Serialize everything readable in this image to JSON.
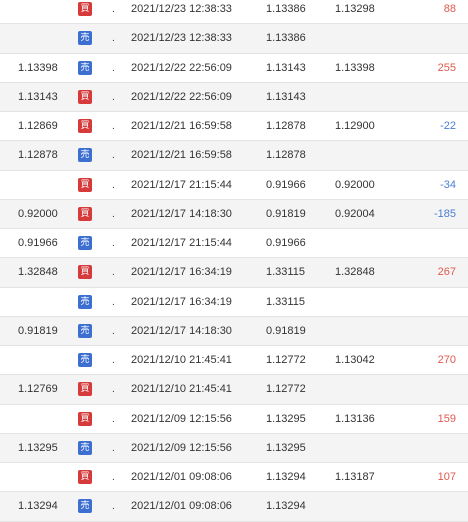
{
  "badges": {
    "buy": "買",
    "sell": "売"
  },
  "colors": {
    "buy_badge": "#d63b3b",
    "sell_badge": "#3d6fd1",
    "profit": "#e05a4f",
    "loss": "#4a7ed6",
    "row_shade": "#f4f4f4"
  },
  "rows": [
    {
      "price1": "",
      "side": "買",
      "dot": ".",
      "datetime": "2021/12/23 12:38:33",
      "price2": "1.13386",
      "price3": "1.13298",
      "pnl": "88"
    },
    {
      "price1": "",
      "side": "売",
      "dot": ".",
      "datetime": "2021/12/23 12:38:33",
      "price2": "1.13386",
      "price3": "",
      "pnl": ""
    },
    {
      "price1": "1.13398",
      "side": "売",
      "dot": ".",
      "datetime": "2021/12/22 22:56:09",
      "price2": "1.13143",
      "price3": "1.13398",
      "pnl": "255"
    },
    {
      "price1": "1.13143",
      "side": "買",
      "dot": ".",
      "datetime": "2021/12/22 22:56:09",
      "price2": "1.13143",
      "price3": "",
      "pnl": ""
    },
    {
      "price1": "1.12869",
      "side": "買",
      "dot": ".",
      "datetime": "2021/12/21 16:59:58",
      "price2": "1.12878",
      "price3": "1.12900",
      "pnl": "-22"
    },
    {
      "price1": "1.12878",
      "side": "売",
      "dot": ".",
      "datetime": "2021/12/21 16:59:58",
      "price2": "1.12878",
      "price3": "",
      "pnl": ""
    },
    {
      "price1": "",
      "side": "買",
      "dot": ".",
      "datetime": "2021/12/17 21:15:44",
      "price2": "0.91966",
      "price3": "0.92000",
      "pnl": "-34"
    },
    {
      "price1": "0.92000",
      "side": "買",
      "dot": ".",
      "datetime": "2021/12/17 14:18:30",
      "price2": "0.91819",
      "price3": "0.92004",
      "pnl": "-185"
    },
    {
      "price1": "0.91966",
      "side": "売",
      "dot": ".",
      "datetime": "2021/12/17 21:15:44",
      "price2": "0.91966",
      "price3": "",
      "pnl": ""
    },
    {
      "price1": "1.32848",
      "side": "買",
      "dot": ".",
      "datetime": "2021/12/17 16:34:19",
      "price2": "1.33115",
      "price3": "1.32848",
      "pnl": "267"
    },
    {
      "price1": "",
      "side": "売",
      "dot": ".",
      "datetime": "2021/12/17 16:34:19",
      "price2": "1.33115",
      "price3": "",
      "pnl": ""
    },
    {
      "price1": "0.91819",
      "side": "売",
      "dot": ".",
      "datetime": "2021/12/17 14:18:30",
      "price2": "0.91819",
      "price3": "",
      "pnl": ""
    },
    {
      "price1": "",
      "side": "売",
      "dot": ".",
      "datetime": "2021/12/10 21:45:41",
      "price2": "1.12772",
      "price3": "1.13042",
      "pnl": "270"
    },
    {
      "price1": "1.12769",
      "side": "買",
      "dot": ".",
      "datetime": "2021/12/10 21:45:41",
      "price2": "1.12772",
      "price3": "",
      "pnl": ""
    },
    {
      "price1": "",
      "side": "買",
      "dot": ".",
      "datetime": "2021/12/09 12:15:56",
      "price2": "1.13295",
      "price3": "1.13136",
      "pnl": "159"
    },
    {
      "price1": "1.13295",
      "side": "売",
      "dot": ".",
      "datetime": "2021/12/09 12:15:56",
      "price2": "1.13295",
      "price3": "",
      "pnl": ""
    },
    {
      "price1": "",
      "side": "買",
      "dot": ".",
      "datetime": "2021/12/01 09:08:06",
      "price2": "1.13294",
      "price3": "1.13187",
      "pnl": "107"
    },
    {
      "price1": "1.13294",
      "side": "売",
      "dot": ".",
      "datetime": "2021/12/01 09:08:06",
      "price2": "1.13294",
      "price3": "",
      "pnl": ""
    }
  ]
}
